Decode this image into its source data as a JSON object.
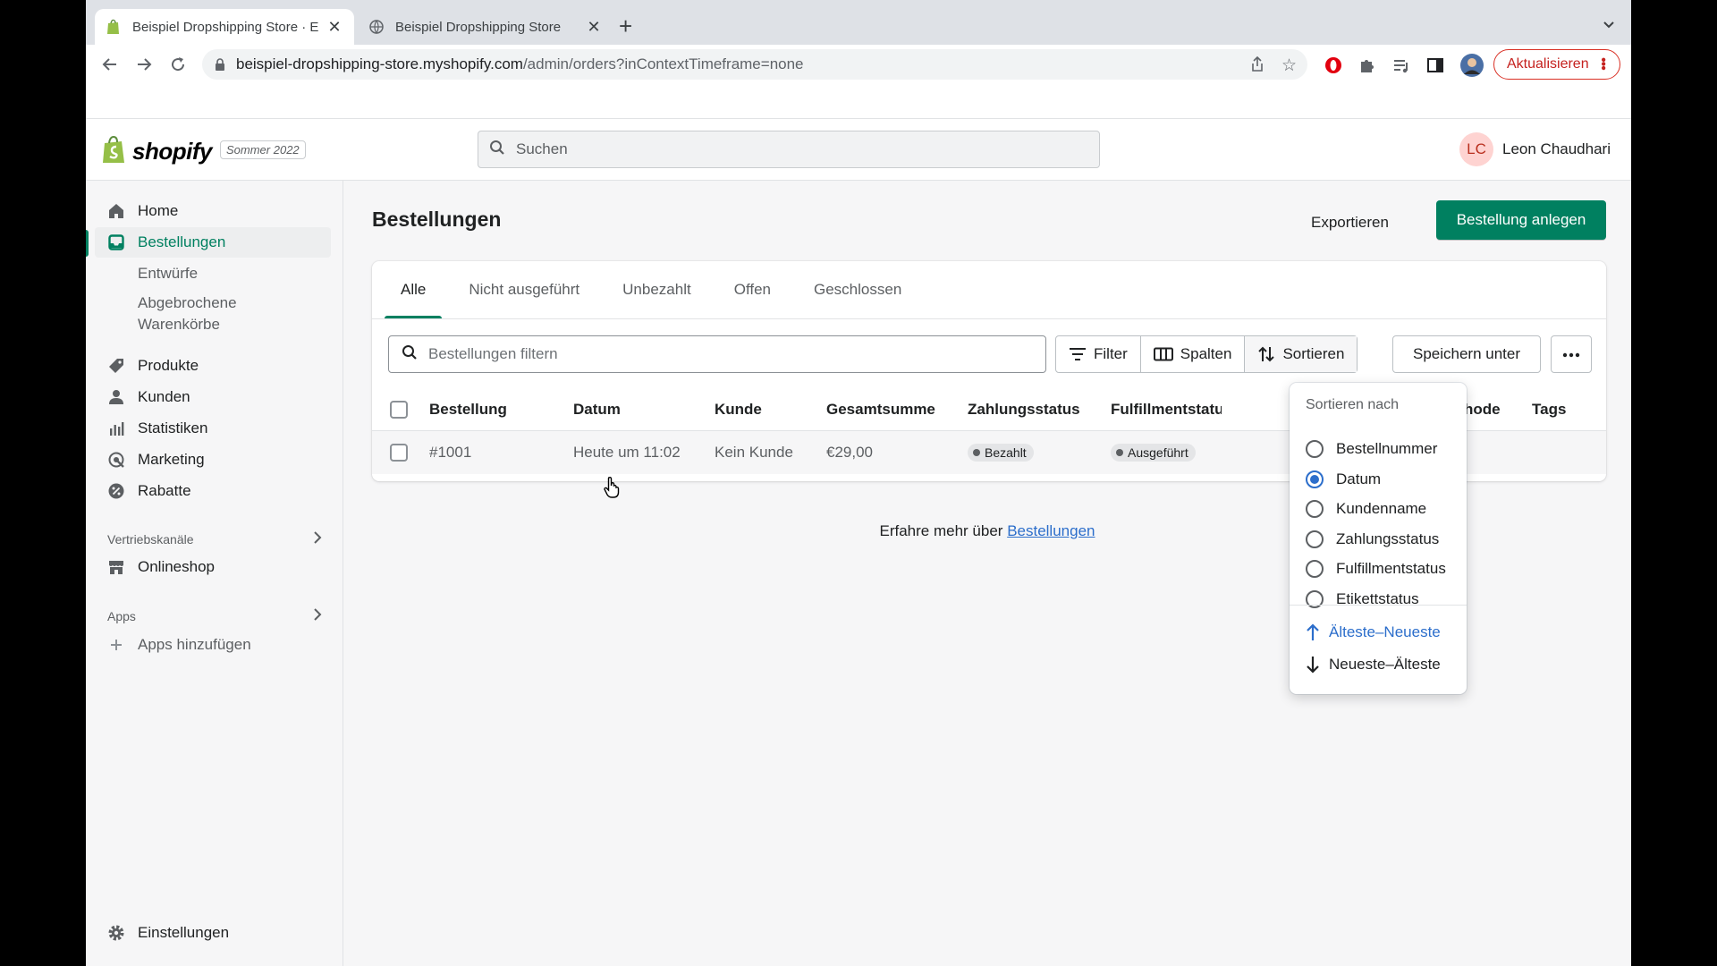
{
  "browser": {
    "tabs": [
      {
        "title": "Beispiel Dropshipping Store · E",
        "active": true
      },
      {
        "title": "Beispiel Dropshipping Store",
        "active": false
      }
    ],
    "url_host": "beispiel-dropshipping-store.myshopify.com",
    "url_path": "/admin/orders?inContextTimeframe=none",
    "update_label": "Aktualisieren"
  },
  "topbar": {
    "logo_text": "shopify",
    "edition": "Sommer 2022",
    "search_placeholder": "Suchen",
    "user_initials": "LC",
    "user_name": "Leon Chaudhari"
  },
  "sidebar": {
    "items": [
      {
        "label": "Home"
      },
      {
        "label": "Bestellungen"
      },
      {
        "label": "Entwürfe"
      },
      {
        "label": "Abgebrochene Warenkörbe"
      },
      {
        "label": "Produkte"
      },
      {
        "label": "Kunden"
      },
      {
        "label": "Statistiken"
      },
      {
        "label": "Marketing"
      },
      {
        "label": "Rabatte"
      }
    ],
    "sales_channels_label": "Vertriebskanäle",
    "onlineshop_label": "Onlineshop",
    "apps_label": "Apps",
    "add_apps_label": "Apps hinzufügen",
    "settings_label": "Einstellungen"
  },
  "page": {
    "title": "Bestellungen",
    "export_label": "Exportieren",
    "create_label": "Bestellung anlegen"
  },
  "orders": {
    "tabs": [
      "Alle",
      "Nicht ausgeführt",
      "Unbezahlt",
      "Offen",
      "Geschlossen"
    ],
    "filter_placeholder": "Bestellungen filtern",
    "filter_label": "Filter",
    "columns_label": "Spalten",
    "sort_label": "Sortieren",
    "save_as_label": "Speichern unter",
    "columns": [
      "Bestellung",
      "Datum",
      "Kunde",
      "Gesamtsumme",
      "Zahlungsstatus",
      "Fulfillmentstatus",
      "Zustellmethode",
      "Tags"
    ],
    "rows": [
      {
        "order": "#1001",
        "date": "Heute um 11:02",
        "customer": "Kein Kunde",
        "total": "€29,00",
        "payment": "Bezahlt",
        "fulfillment": "Ausgeführt"
      }
    ],
    "learn_more_text": "Erfahre mehr über ",
    "learn_more_link": "Bestellungen"
  },
  "sort_popover": {
    "title": "Sortieren nach",
    "options": [
      "Bestellnummer",
      "Datum",
      "Kundenname",
      "Zahlungsstatus",
      "Fulfillmentstatus",
      "Etikettstatus"
    ],
    "selected": "Datum",
    "asc_label": "Älteste–Neueste",
    "desc_label": "Neueste–Älteste"
  },
  "colors": {
    "primary": "#008060",
    "link": "#2c6ecb"
  }
}
